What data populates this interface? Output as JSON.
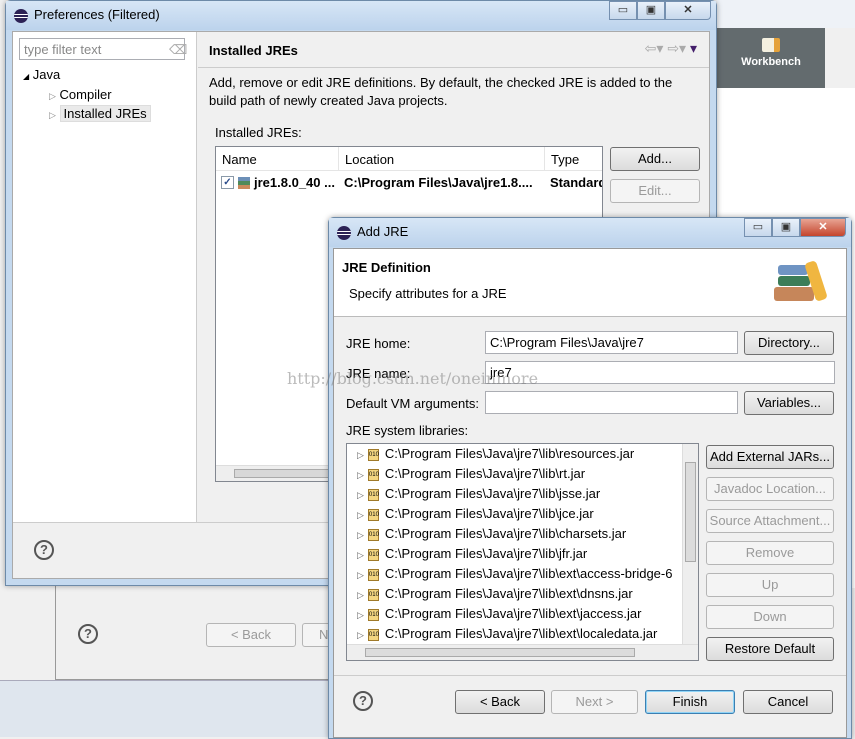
{
  "background": {
    "workbench_label": "Workbench",
    "watermark": "http://blog.csdn.net/oneinmore",
    "behind_dialog": {
      "back_label": "< Back",
      "next_partial": "N"
    }
  },
  "preferences": {
    "title": "Preferences (Filtered)",
    "filter_placeholder": "type filter text",
    "tree": {
      "root": "Java",
      "children": [
        "Compiler",
        "Installed JREs"
      ],
      "selected": "Installed JREs"
    },
    "page_title": "Installed JREs",
    "description": "Add, remove or edit JRE definitions. By default, the checked JRE is added to the build path of newly created Java projects.",
    "table_label": "Installed JREs:",
    "columns": [
      "Name",
      "Location",
      "Type"
    ],
    "rows": [
      {
        "checked": true,
        "name": "jre1.8.0_40 ...",
        "location": "C:\\Program Files\\Java\\jre1.8....",
        "type": "Standard"
      }
    ],
    "buttons": {
      "add": "Add...",
      "edit": "Edit..."
    },
    "help": "?"
  },
  "add_jre": {
    "title": "Add JRE",
    "header_title": "JRE Definition",
    "header_subtitle": "Specify attributes for a JRE",
    "jre_home_label": "JRE home:",
    "jre_home_value": "C:\\Program Files\\Java\\jre7",
    "directory_button": "Directory...",
    "jre_name_label": "JRE name:",
    "jre_name_value": "jre7",
    "vm_args_label": "Default VM arguments:",
    "vm_args_value": "",
    "variables_button": "Variables...",
    "libraries_label": "JRE system libraries:",
    "libraries": [
      "C:\\Program Files\\Java\\jre7\\lib\\resources.jar",
      "C:\\Program Files\\Java\\jre7\\lib\\rt.jar",
      "C:\\Program Files\\Java\\jre7\\lib\\jsse.jar",
      "C:\\Program Files\\Java\\jre7\\lib\\jce.jar",
      "C:\\Program Files\\Java\\jre7\\lib\\charsets.jar",
      "C:\\Program Files\\Java\\jre7\\lib\\jfr.jar",
      "C:\\Program Files\\Java\\jre7\\lib\\ext\\access-bridge-6",
      "C:\\Program Files\\Java\\jre7\\lib\\ext\\dnsns.jar",
      "C:\\Program Files\\Java\\jre7\\lib\\ext\\jaccess.jar",
      "C:\\Program Files\\Java\\jre7\\lib\\ext\\localedata.jar"
    ],
    "side_buttons": {
      "add_external": "Add External JARs...",
      "javadoc": "Javadoc Location...",
      "source": "Source Attachment...",
      "remove": "Remove",
      "up": "Up",
      "down": "Down",
      "restore": "Restore Default"
    },
    "footer": {
      "back": "< Back",
      "next": "Next >",
      "finish": "Finish",
      "cancel": "Cancel"
    },
    "help": "?"
  }
}
